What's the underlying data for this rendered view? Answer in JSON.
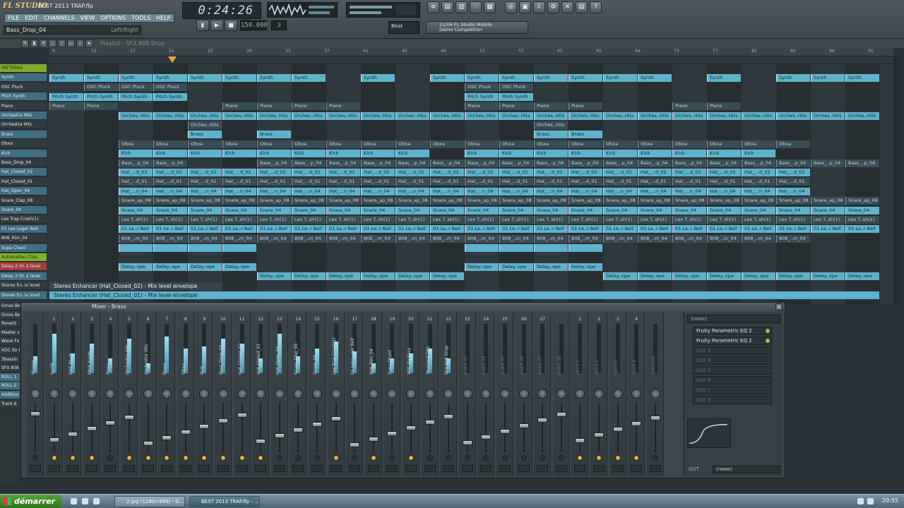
{
  "app": {
    "logo": "FL STUDIO",
    "project_title": "BEST 2013 TRAP.flp",
    "menu": [
      "FILE",
      "EDIT",
      "CHANNELS",
      "VIEW",
      "OPTIONS",
      "TOOLS",
      "HELP"
    ],
    "hint_text": "Bass_Drop_04",
    "hint_right": "Left/Right",
    "time": "0:24:26",
    "tempo": "150.000",
    "pattern": "3",
    "snap": "Beat",
    "news": "21/06 FL Studio Mobile\nDemo Competition"
  },
  "playlist": {
    "title": "Playlist - SFX 808 Drop",
    "ruler": [
      "9",
      "13",
      "17",
      "21",
      "25",
      "29",
      "33",
      "37",
      "41",
      "45",
      "49",
      "53",
      "57",
      "61",
      "65",
      "69",
      "73",
      "77",
      "81",
      "85",
      "89",
      "91"
    ],
    "tracks": [
      {
        "label": "PATTERNS",
        "style": "green"
      },
      {
        "label": "Synth",
        "style": "teal"
      },
      {
        "label": "OSC Pluck",
        "style": "dark"
      },
      {
        "label": "Pitch Synth",
        "style": "teal"
      },
      {
        "label": "Piano",
        "style": "dark"
      },
      {
        "label": "Orchestra Hits",
        "style": "teal"
      },
      {
        "label": "Orchestra Hits",
        "style": "dark"
      },
      {
        "label": "Brass",
        "style": "teal"
      },
      {
        "label": "Obxa",
        "style": "dark"
      },
      {
        "label": "Kick",
        "style": "teal"
      },
      {
        "label": "Bass_Drop_04",
        "style": "dark"
      },
      {
        "label": "Hat_Closed_02",
        "style": "teal"
      },
      {
        "label": "Hat_Closed_01",
        "style": "dark"
      },
      {
        "label": "Hat_Open_04",
        "style": "teal"
      },
      {
        "label": "Snare_Clap_08",
        "style": "dark"
      },
      {
        "label": "Snare_04",
        "style": "teal"
      },
      {
        "label": "Lex Trap Crash(1)",
        "style": "dark"
      },
      {
        "label": "01 Lex Luger Bell",
        "style": "teal"
      },
      {
        "label": "808_Rim_04",
        "style": "dark"
      },
      {
        "label": "Supa Chant",
        "style": "teal"
      },
      {
        "label": "Automation Clips",
        "style": "green"
      },
      {
        "label": "Delay 2 (H..k level",
        "style": "red"
      },
      {
        "label": "Delay 2 (H..k level",
        "style": "teal"
      },
      {
        "label": "Stereo En..ix level",
        "style": "dark"
      },
      {
        "label": "Stereo En..ix level",
        "style": "teal"
      }
    ],
    "clip_names": [
      "Synth",
      "OSC Pluck",
      "Pitch Synth",
      "Piano",
      "Orches..Hits",
      "Orches..Hits",
      "Brass",
      "Obxa",
      "Kick",
      "Bass_..p_04",
      "Hat_...d_02",
      "Hat_...d_01",
      "Hat_...n_04",
      "Snare_ap_08",
      "Snare_04",
      "Lex T..sh(1)",
      "01 Le..r Bell",
      "808_..m_04",
      "",
      "",
      "Delay..ope",
      "Delay..ope"
    ],
    "envelope_1": "Stereo Enhancer (Hat_Closed_02) - Mix level envelope",
    "envelope_2": "Stereo Enhancer (Hat_Closed_01) - Mix level envelope"
  },
  "mixer": {
    "title": "Mixer - Brass",
    "strips": [
      {
        "num": "",
        "name": "Master",
        "level": 0.35,
        "route": false,
        "dim": false
      },
      {
        "num": "1",
        "name": "Synth",
        "level": 0.8,
        "route": true,
        "dim": false
      },
      {
        "num": "2",
        "name": "OSC Pluck",
        "level": 0.4,
        "route": true,
        "dim": false
      },
      {
        "num": "3",
        "name": "Pitch Synth",
        "level": 0.6,
        "route": true,
        "dim": false
      },
      {
        "num": "4",
        "name": "Piano",
        "level": 0.3,
        "route": false,
        "dim": false
      },
      {
        "num": "5",
        "name": "Orchestra Hits",
        "level": 0.7,
        "route": true,
        "dim": false
      },
      {
        "num": "6",
        "name": "Orchestra Hits",
        "level": 0.2,
        "route": true,
        "dim": false
      },
      {
        "num": "7",
        "name": "Brass",
        "level": 0.75,
        "route": true,
        "dim": false
      },
      {
        "num": "8",
        "name": "Obxa",
        "level": 0.5,
        "route": true,
        "dim": false
      },
      {
        "num": "9",
        "name": "Kick",
        "level": 0.55,
        "route": true,
        "dim": false
      },
      {
        "num": "10",
        "name": "Bass_Drop_04",
        "level": 0.7,
        "route": true,
        "dim": false
      },
      {
        "num": "11",
        "name": "Hat_Closed_02",
        "level": 0.6,
        "route": true,
        "dim": false
      },
      {
        "num": "12",
        "name": "Hat_Closed_01",
        "level": 0.3,
        "route": true,
        "dim": false
      },
      {
        "num": "13",
        "name": "Hat_Open_04",
        "level": 0.8,
        "route": false,
        "dim": false
      },
      {
        "num": "14",
        "name": "Snare_Clap_08",
        "level": 0.35,
        "route": false,
        "dim": false
      },
      {
        "num": "15",
        "name": "Snare_04",
        "level": 0.5,
        "route": false,
        "dim": false
      },
      {
        "num": "16",
        "name": "Lex Trap Crash(1)",
        "level": 0.65,
        "route": true,
        "dim": false
      },
      {
        "num": "17",
        "name": "01 Lex Luger Bell",
        "level": 0.45,
        "route": false,
        "dim": false
      },
      {
        "num": "18",
        "name": "808_Rim_04",
        "level": 0.2,
        "route": true,
        "dim": false
      },
      {
        "num": "19",
        "name": "Supa Chant",
        "level": 0.3,
        "route": false,
        "dim": false
      },
      {
        "num": "20",
        "name": "VOC So Easy",
        "level": 0.4,
        "route": true,
        "dim": false
      },
      {
        "num": "21",
        "name": "3bassin3 TAG",
        "level": 0.5,
        "route": false,
        "dim": false
      },
      {
        "num": "22",
        "name": "SFX 808 Drop",
        "level": 0.3,
        "route": false,
        "dim": false
      },
      {
        "num": "23",
        "name": "Insert 23",
        "level": 0,
        "route": false,
        "dim": true
      },
      {
        "num": "24",
        "name": "Insert 24",
        "level": 0,
        "route": false,
        "dim": true
      },
      {
        "num": "25",
        "name": "Insert 25",
        "level": 0,
        "route": false,
        "dim": true
      },
      {
        "num": "26",
        "name": "Insert 26",
        "level": 0,
        "route": false,
        "dim": true
      },
      {
        "num": "27",
        "name": "Insert 27",
        "level": 0,
        "route": false,
        "dim": true
      },
      {
        "num": "",
        "name": "Insert 28",
        "level": 0,
        "route": false,
        "dim": true
      },
      {
        "num": "1",
        "name": "Send 1",
        "level": 0,
        "route": true,
        "dim": true
      },
      {
        "num": "2",
        "name": "Send 2",
        "level": 0,
        "route": true,
        "dim": true
      },
      {
        "num": "3",
        "name": "Send 3",
        "level": 0,
        "route": true,
        "dim": true
      },
      {
        "num": "4",
        "name": "Send 4",
        "level": 0,
        "route": true,
        "dim": true
      },
      {
        "num": "",
        "name": "Selected",
        "level": 0,
        "route": false,
        "dim": true
      }
    ],
    "insert_name": "(none)",
    "slots": [
      "Fruity Parametric EQ 2",
      "Fruity Parametric EQ 2",
      "Slot 3",
      "Slot 4",
      "Slot 5",
      "Slot 6",
      "Slot 7",
      "Slot 8"
    ],
    "out_label": "OUT",
    "out_value": "(none)"
  },
  "lower_tracks": [
    "Gross Be",
    "Gross Be",
    "Reverb",
    "Master v",
    "Wave Fo",
    "VOC So E",
    "3bassin",
    "SFX 808",
    "ROLL 1",
    "ROLL 2",
    "Addition",
    "Track 6"
  ],
  "taskbar": {
    "start": "démarrer",
    "tasks": [
      "2.jpg (1280×993) - G...",
      "BEST 2013 TRAP.flp - ..."
    ],
    "clock": "20:55"
  }
}
